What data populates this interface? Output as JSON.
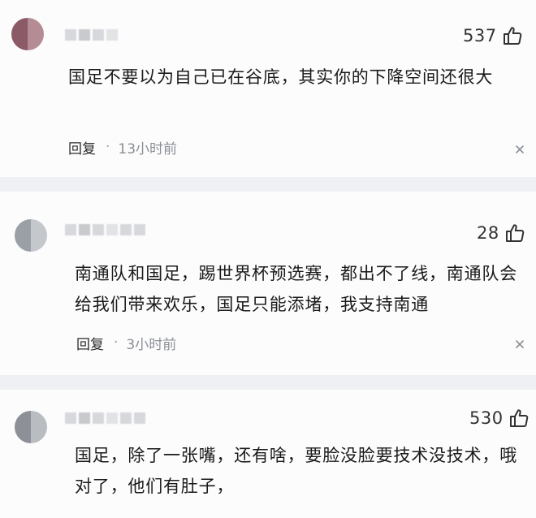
{
  "comments": [
    {
      "likes": "537",
      "text": "国足不要以为自己已在谷底，其实你的下降空间还很大",
      "reply_label": "回复",
      "separator": "·",
      "time": "13小时前",
      "avatar_colors": [
        "#8a5a66",
        "#b58b94"
      ]
    },
    {
      "likes": "28",
      "text": "南通队和国足，踢世界杯预选赛，都出不了线，南通队会给我们带来欢乐，国足只能添堵，我支持南通",
      "reply_label": "回复",
      "separator": "·",
      "time": "3小时前",
      "avatar_colors": [
        "#9aa0a6",
        "#c4c7cb"
      ]
    },
    {
      "likes": "530",
      "text": "国足，除了一张嘴，还有啥，要脸没脸要技术没技术，哦对了，他们有肚子，",
      "avatar_colors": [
        "#8d9096",
        "#b9bcc0"
      ]
    }
  ],
  "icons": {
    "like": "thumbs-up-icon",
    "close": "close-icon"
  }
}
